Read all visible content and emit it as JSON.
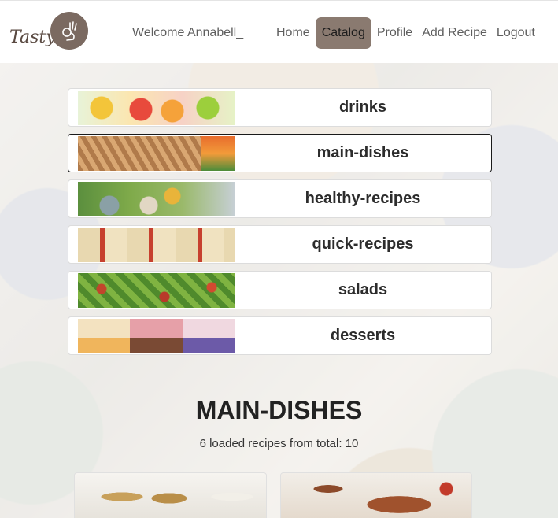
{
  "navbar": {
    "logo_text": "Tasty",
    "welcome": "Welcome Annabell_",
    "links": [
      {
        "label": "Home",
        "active": false
      },
      {
        "label": "Catalog",
        "active": true
      },
      {
        "label": "Profile",
        "active": false
      },
      {
        "label": "Add Recipe",
        "active": false
      },
      {
        "label": "Logout",
        "active": false
      }
    ]
  },
  "categories": [
    {
      "label": "drinks",
      "selected": false
    },
    {
      "label": "main-dishes",
      "selected": true
    },
    {
      "label": "healthy-recipes",
      "selected": false
    },
    {
      "label": "quick-recipes",
      "selected": false
    },
    {
      "label": "salads",
      "selected": false
    },
    {
      "label": "desserts",
      "selected": false
    }
  ],
  "section": {
    "title": "MAIN-DISHES",
    "subtitle": "6 loaded recipes from total: 10"
  },
  "colors": {
    "active_nav": "#8a7a70",
    "logo_brown": "#7b6a61"
  }
}
